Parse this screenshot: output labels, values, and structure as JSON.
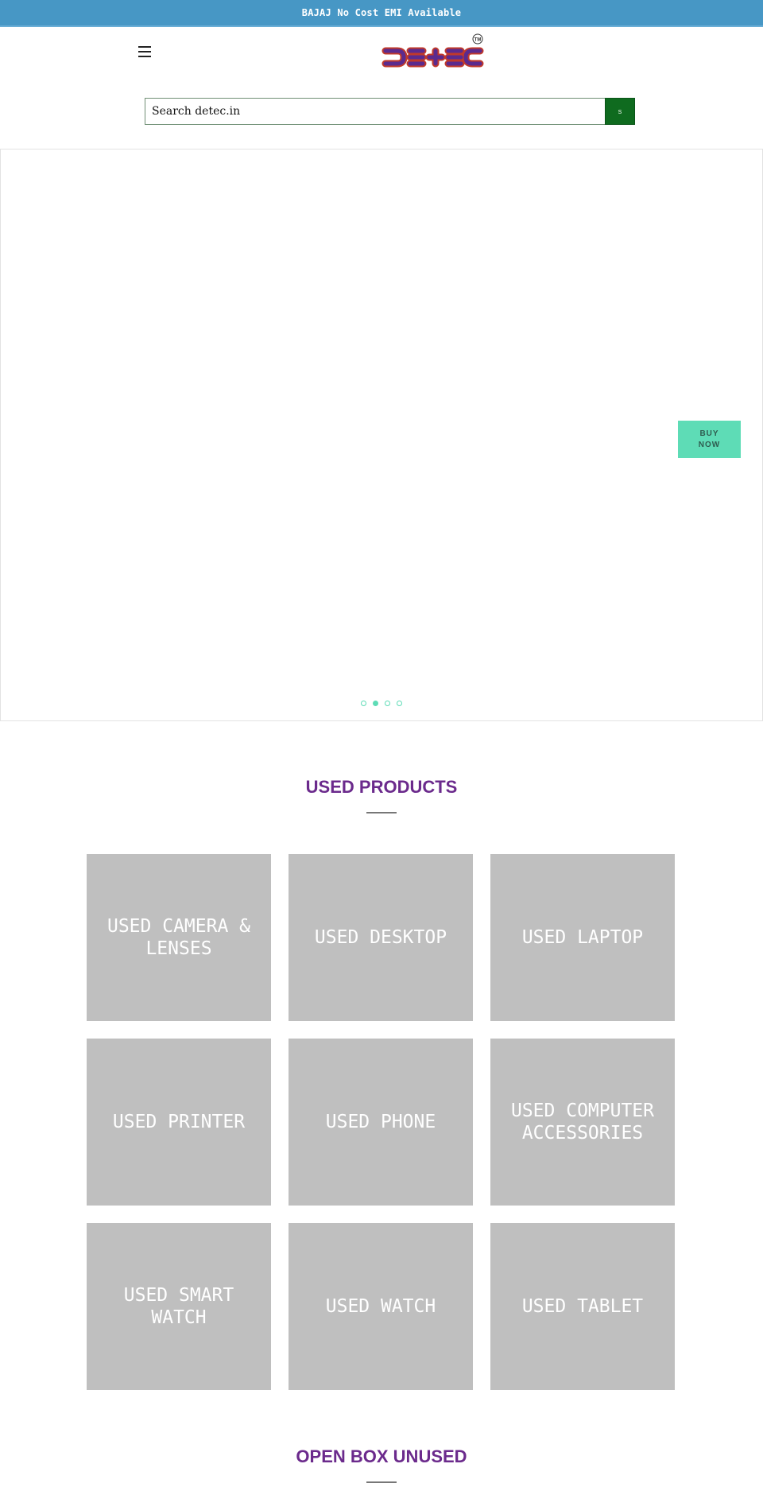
{
  "announcement": {
    "text": "BAJAJ No Cost EMI Available",
    "bg_color": "#4797c5"
  },
  "header": {
    "menu_icon": "hamburger-menu-icon",
    "logo": {
      "text": "DETEC",
      "trademark": "TM",
      "fill_color": "#6b2a8c",
      "outline_color": "#c0392b"
    }
  },
  "search": {
    "placeholder": "Search detec.in",
    "value": "",
    "button_label": "s",
    "button_color": "#0f6b1f"
  },
  "hero": {
    "cta_label_line1": "BUY",
    "cta_label_line2": "NOW",
    "cta_color": "#5edcb6",
    "slides_count": 4,
    "active_slide_index": 1
  },
  "sections": [
    {
      "title": "USED PRODUCTS",
      "title_color": "#6b2a8c",
      "categories": [
        {
          "label": "USED CAMERA & LENSES"
        },
        {
          "label": "USED DESKTOP"
        },
        {
          "label": "USED LAPTOP"
        },
        {
          "label": "USED PRINTER"
        },
        {
          "label": "USED PHONE"
        },
        {
          "label": "USED COMPUTER ACCESSORIES"
        },
        {
          "label": "USED SMART WATCH"
        },
        {
          "label": "USED WATCH"
        },
        {
          "label": "USED TABLET"
        }
      ]
    },
    {
      "title": "OPEN BOX UNUSED",
      "title_color": "#6b2a8c"
    }
  ]
}
